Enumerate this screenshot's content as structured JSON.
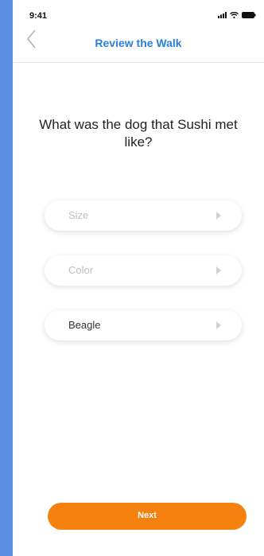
{
  "status_bar": {
    "time": "9:41"
  },
  "header": {
    "title": "Review the Walk",
    "back_icon": "chevron-left-icon"
  },
  "question": {
    "text": "What was the dog that Sushi met like?"
  },
  "options": [
    {
      "label": "Size",
      "filled": false
    },
    {
      "label": "Color",
      "filled": false
    },
    {
      "label": "Beagle",
      "filled": true
    }
  ],
  "footer": {
    "next_label": "Next"
  },
  "colors": {
    "accent": "#2b7fd9",
    "button": "#f5820f",
    "page_background": "#5b8ee0",
    "placeholder_text": "#bfbfbf"
  }
}
